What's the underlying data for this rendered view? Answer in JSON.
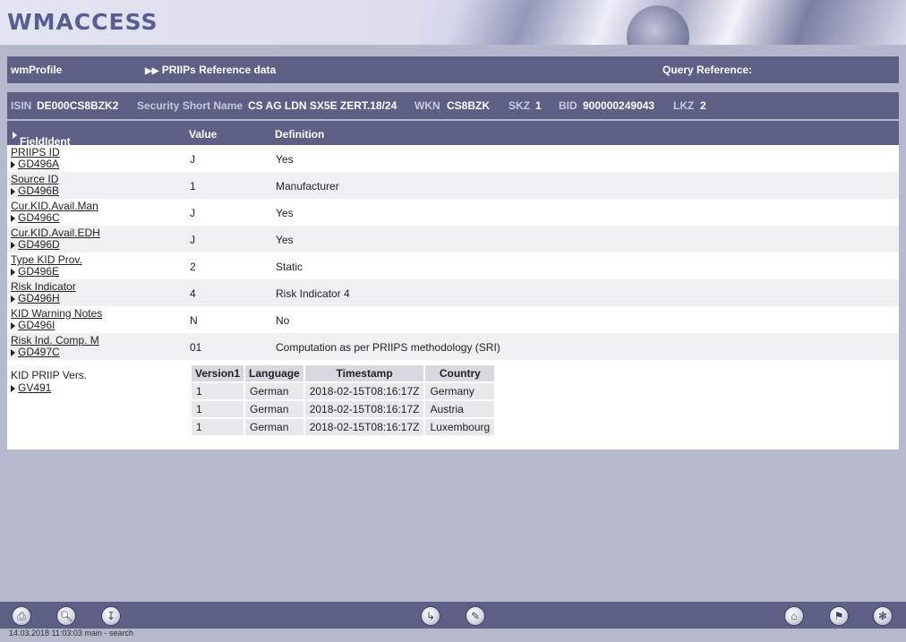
{
  "app": {
    "logo": "WMACCESS"
  },
  "nav": {
    "profile": "wmProfile",
    "section": "PRIIPs Reference data",
    "query_label": "Query Reference:"
  },
  "security": {
    "isin_label": "ISIN",
    "isin": "DE000CS8BZK2",
    "short_name_label": "Security Short Name",
    "short_name": "CS AG LDN SX5E ZERT.18/24",
    "wkn_label": "WKN",
    "wkn": "CS8BZK",
    "skz_label": "SKZ",
    "skz": "1",
    "bid_label": "BID",
    "bid": "900000249043",
    "lkz_label": "LKZ",
    "lkz": "2"
  },
  "table": {
    "headers": {
      "field": "FieldIdent",
      "value": "Value",
      "definition": "Definition"
    },
    "rows": [
      {
        "name": "PRIIPS ID",
        "code": "GD496A",
        "value": "J",
        "definition": "Yes"
      },
      {
        "name": "Source ID",
        "code": "GD496B",
        "value": "1",
        "definition": "Manufacturer"
      },
      {
        "name": "Cur.KID.Avail.Man",
        "code": "GD496C",
        "value": "J",
        "definition": "Yes"
      },
      {
        "name": "Cur.KID.Avail.EDH",
        "code": "GD496D",
        "value": "J",
        "definition": "Yes"
      },
      {
        "name": "Type KID Prov.",
        "code": "GD496E",
        "value": "2",
        "definition": "Static"
      },
      {
        "name": "Risk Indicator",
        "code": "GD496H",
        "value": "4",
        "definition": "Risk Indicator 4"
      },
      {
        "name": "KID Warning Notes",
        "code": "GD496I",
        "value": "N",
        "definition": "No"
      },
      {
        "name": "Risk Ind. Comp. M",
        "code": "GD497C",
        "value": "01",
        "definition": "Computation as per PRIIPS methodology (SRI)"
      }
    ],
    "kid": {
      "name": "KID PRIIP Vers.",
      "code": "GV491",
      "headers": [
        "Version1",
        "Language",
        "Timestamp",
        "Country"
      ],
      "rows": [
        [
          "1",
          "German",
          "2018-02-15T08:16:17Z",
          "Germany"
        ],
        [
          "1",
          "German",
          "2018-02-15T08:16:17Z",
          "Austria"
        ],
        [
          "1",
          "German",
          "2018-02-15T08:16:17Z",
          "Luxembourg"
        ]
      ]
    }
  },
  "footer": {
    "icons": [
      "print-icon",
      "preview-icon",
      "download-icon",
      "export-icon",
      "edit-icon",
      "home-icon",
      "flag-icon",
      "settings-icon"
    ]
  },
  "status": "14.03.2018 11:03:03 main - search"
}
